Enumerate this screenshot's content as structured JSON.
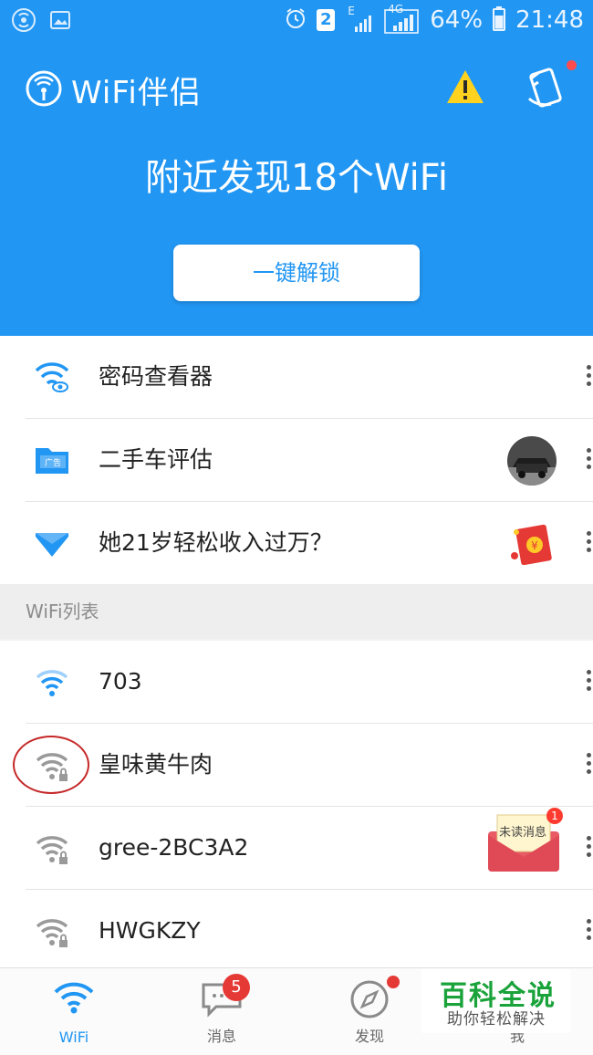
{
  "status_bar": {
    "network_type_e": "E",
    "network_type_4g": "4G",
    "sim_badge": "2",
    "battery": "64%",
    "time": "21:48"
  },
  "header": {
    "app_title": "WiFi伴侣",
    "headline": "附近发现18个WiFi",
    "unlock_button": "一键解锁"
  },
  "tools": [
    {
      "label": "密码查看器",
      "icon": "wifi-eye-icon"
    },
    {
      "label": "二手车评估",
      "icon": "folder-ad-icon",
      "ad_tag": "广告"
    },
    {
      "label": "她21岁轻松收入过万？",
      "icon": "mail-check-icon"
    }
  ],
  "wifi_section_title": "WiFi列表",
  "wifi_list": [
    {
      "name": "703",
      "locked": false
    },
    {
      "name": "皇味黄牛肉",
      "locked": true
    },
    {
      "name": "gree-2BC3A2",
      "locked": true
    },
    {
      "name": "HWGKZY",
      "locked": true
    }
  ],
  "floating_envelope": {
    "label": "未读消息",
    "count": "1"
  },
  "tabs": [
    {
      "label": "WiFi",
      "active": true
    },
    {
      "label": "消息",
      "badge": "5"
    },
    {
      "label": "发现",
      "dot": true
    },
    {
      "label": "我"
    }
  ],
  "watermark": {
    "title": "百科全说",
    "subtitle": "助你轻松解决"
  },
  "colors": {
    "primary": "#2196f3",
    "alert": "#e53935",
    "warn": "#ffd21f",
    "green": "#1aa33a"
  }
}
